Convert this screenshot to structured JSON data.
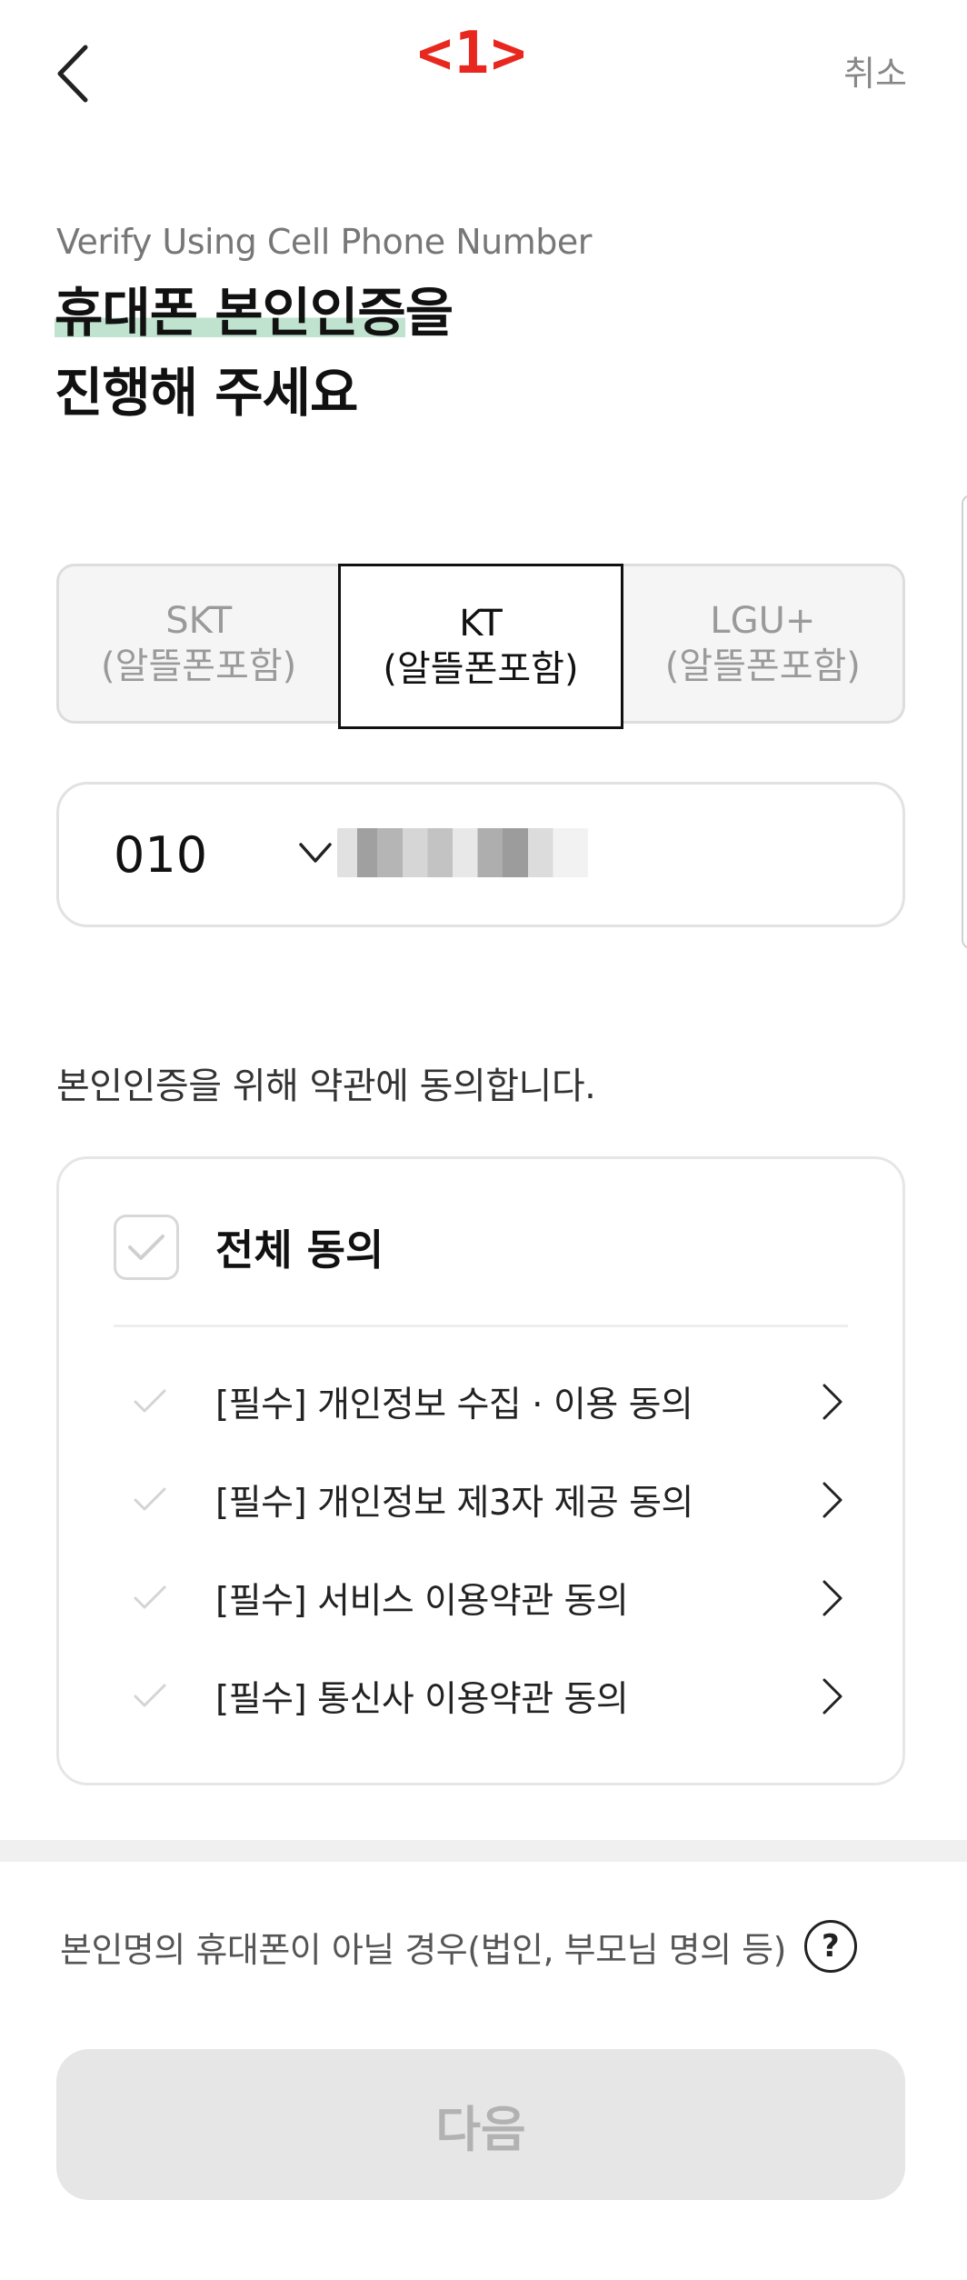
{
  "header": {
    "step_marker": "<1>",
    "cancel_label": "취소"
  },
  "heading": {
    "subtitle": "Verify Using Cell Phone Number",
    "title_highlight": "휴대폰 본인인증",
    "title_rest_line1": "을",
    "title_line2": "진행해 주세요"
  },
  "carriers": [
    {
      "name": "SKT",
      "sub": "(알뜰폰포함)",
      "selected": false
    },
    {
      "name": "KT",
      "sub": "(알뜰폰포함)",
      "selected": true
    },
    {
      "name": "LGU+",
      "sub": "(알뜰폰포함)",
      "selected": false
    }
  ],
  "phone": {
    "prefix": "010"
  },
  "terms": {
    "caption": "본인인증을 위해 약관에 동의합니다.",
    "agree_all_label": "전체 동의",
    "items": [
      {
        "label": "[필수] 개인정보 수집 · 이용 동의"
      },
      {
        "label": "[필수] 개인정보 제3자 제공 동의"
      },
      {
        "label": "[필수] 서비스 이용약관 동의"
      },
      {
        "label": "[필수] 통신사 이용약관 동의"
      }
    ]
  },
  "footer": {
    "other_owner_label": "본인명의 휴대폰이 아닐 경우(법인, 부모님 명의 등)",
    "help_icon_glyph": "?",
    "next_label": "다음"
  },
  "colors": {
    "step_marker": "#e8281e",
    "highlight": "#bfe3cf",
    "disabled_button_bg": "#e6e6e6",
    "disabled_button_text": "#b2b2b2"
  }
}
